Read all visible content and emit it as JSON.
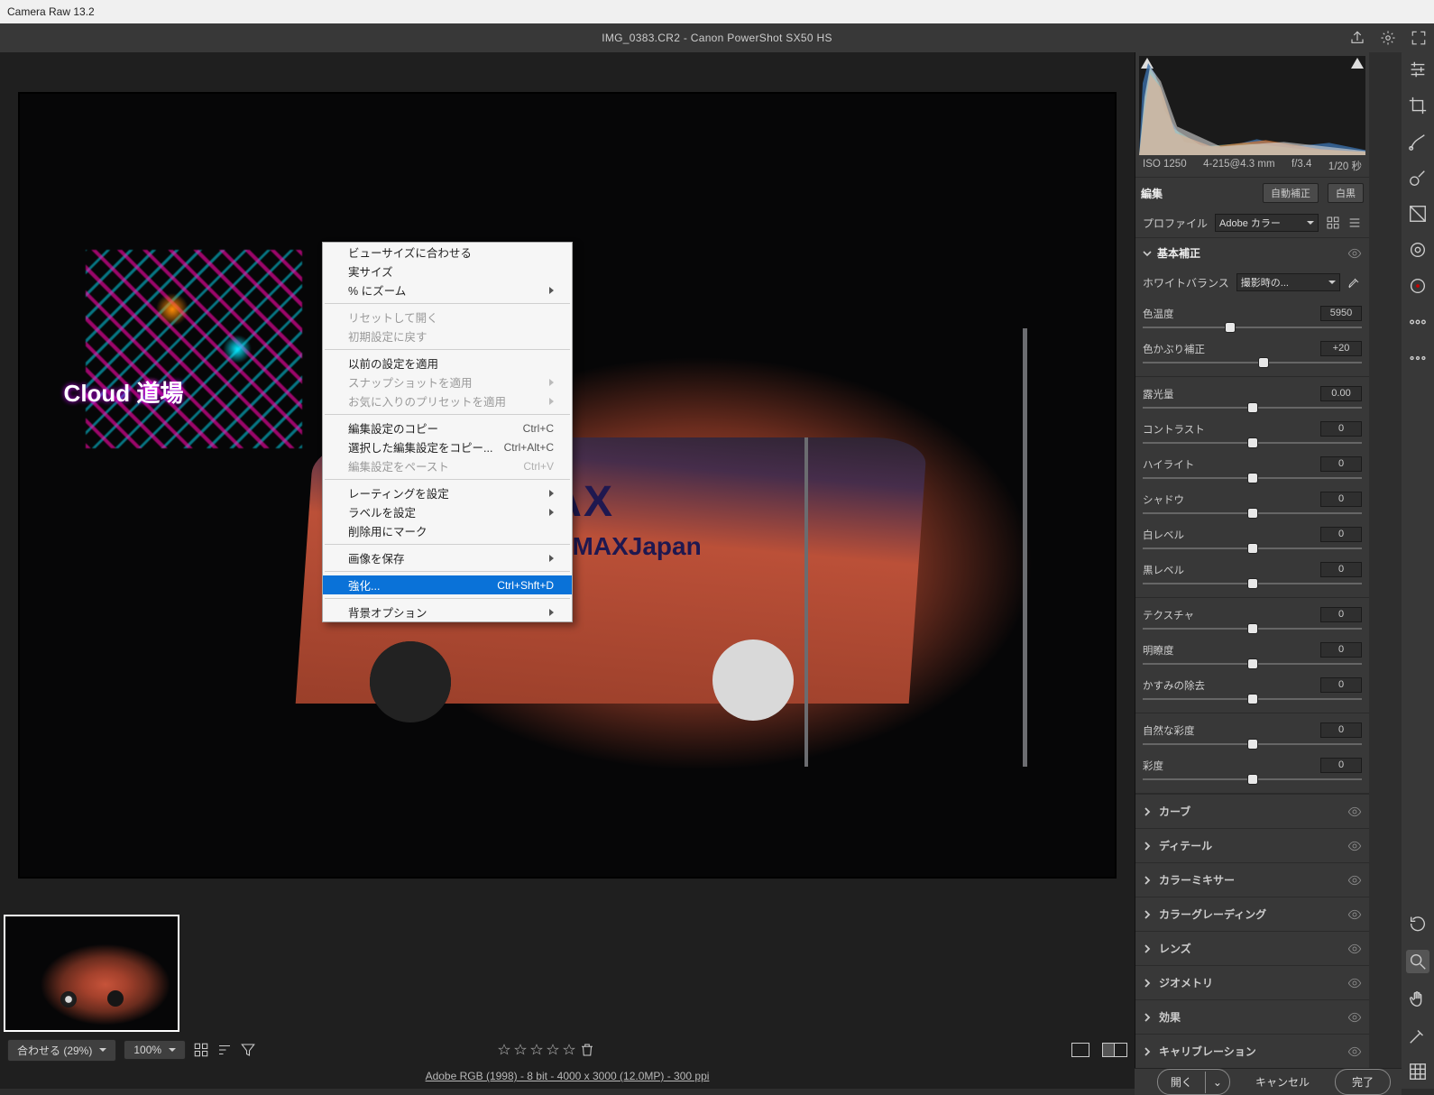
{
  "window_title": "Camera Raw 13.2",
  "header": {
    "title": "IMG_0383.CR2  -  Canon PowerShot SX50 HS"
  },
  "photo": {
    "logo": "MAX",
    "tag": "#AdobeMAXJapan",
    "neon_text": "Cloud 道場"
  },
  "context_menu": {
    "groups": [
      [
        {
          "label": "ビューサイズに合わせる",
          "enabled": true
        },
        {
          "label": "実サイズ",
          "enabled": true
        },
        {
          "label": "% にズーム",
          "enabled": true,
          "submenu": true
        }
      ],
      [
        {
          "label": "リセットして開く",
          "enabled": false
        },
        {
          "label": "初期設定に戻す",
          "enabled": false
        }
      ],
      [
        {
          "label": "以前の設定を適用",
          "enabled": true
        },
        {
          "label": "スナップショットを適用",
          "enabled": false,
          "submenu": true
        },
        {
          "label": "お気に入りのプリセットを適用",
          "enabled": false,
          "submenu": true
        }
      ],
      [
        {
          "label": "編集設定のコピー",
          "enabled": true,
          "shortcut": "Ctrl+C"
        },
        {
          "label": "選択した編集設定をコピー...",
          "enabled": true,
          "shortcut": "Ctrl+Alt+C"
        },
        {
          "label": "編集設定をペースト",
          "enabled": false,
          "shortcut": "Ctrl+V"
        }
      ],
      [
        {
          "label": "レーティングを設定",
          "enabled": true,
          "submenu": true
        },
        {
          "label": "ラベルを設定",
          "enabled": true,
          "submenu": true
        },
        {
          "label": "削除用にマーク",
          "enabled": true
        }
      ],
      [
        {
          "label": "画像を保存",
          "enabled": true,
          "submenu": true
        }
      ],
      [
        {
          "label": "強化...",
          "enabled": true,
          "shortcut": "Ctrl+Shft+D",
          "hot": true
        }
      ],
      [
        {
          "label": "背景オプション",
          "enabled": true,
          "submenu": true
        }
      ]
    ]
  },
  "bottom": {
    "fit_label": "合わせる (29%)",
    "zoom_label": "100%",
    "info": "Adobe RGB (1998) - 8 bit - 4000 x 3000 (12.0MP) - 300 ppi"
  },
  "meta": {
    "iso": "ISO 1250",
    "lens": "4-215@4.3 mm",
    "aperture": "f/3.4",
    "shutter": "1/20 秒"
  },
  "edit_tabs": {
    "label": "編集",
    "auto": "自動補正",
    "bw": "白黒"
  },
  "profile_row": {
    "label": "プロファイル",
    "value": "Adobe カラー"
  },
  "basic": {
    "header": "基本補正",
    "wb_label": "ホワイトバランス",
    "wb_value": "撮影時の...",
    "sliders": [
      {
        "label": "色温度",
        "value": "5950",
        "pos": 40,
        "grad": "grad-by"
      },
      {
        "label": "色かぶり補正",
        "value": "+20",
        "pos": 55,
        "grad": "grad-gm"
      }
    ],
    "sliders2": [
      {
        "label": "露光量",
        "value": "0.00",
        "pos": 50
      },
      {
        "label": "コントラスト",
        "value": "0",
        "pos": 50
      },
      {
        "label": "ハイライト",
        "value": "0",
        "pos": 50
      },
      {
        "label": "シャドウ",
        "value": "0",
        "pos": 50
      },
      {
        "label": "白レベル",
        "value": "0",
        "pos": 50
      },
      {
        "label": "黒レベル",
        "value": "0",
        "pos": 50
      }
    ],
    "sliders3": [
      {
        "label": "テクスチャ",
        "value": "0",
        "pos": 50
      },
      {
        "label": "明瞭度",
        "value": "0",
        "pos": 50
      },
      {
        "label": "かすみの除去",
        "value": "0",
        "pos": 50
      }
    ],
    "sliders4": [
      {
        "label": "自然な彩度",
        "value": "0",
        "pos": 50,
        "grad": "grad-nat"
      },
      {
        "label": "彩度",
        "value": "0",
        "pos": 50,
        "grad": "grad-sat"
      }
    ]
  },
  "panels": [
    "カーブ",
    "ディテール",
    "カラーミキサー",
    "カラーグレーディング",
    "レンズ",
    "ジオメトリ",
    "効果",
    "キャリブレーション"
  ],
  "actions": {
    "open": "開く",
    "cancel": "キャンセル",
    "done": "完了"
  }
}
